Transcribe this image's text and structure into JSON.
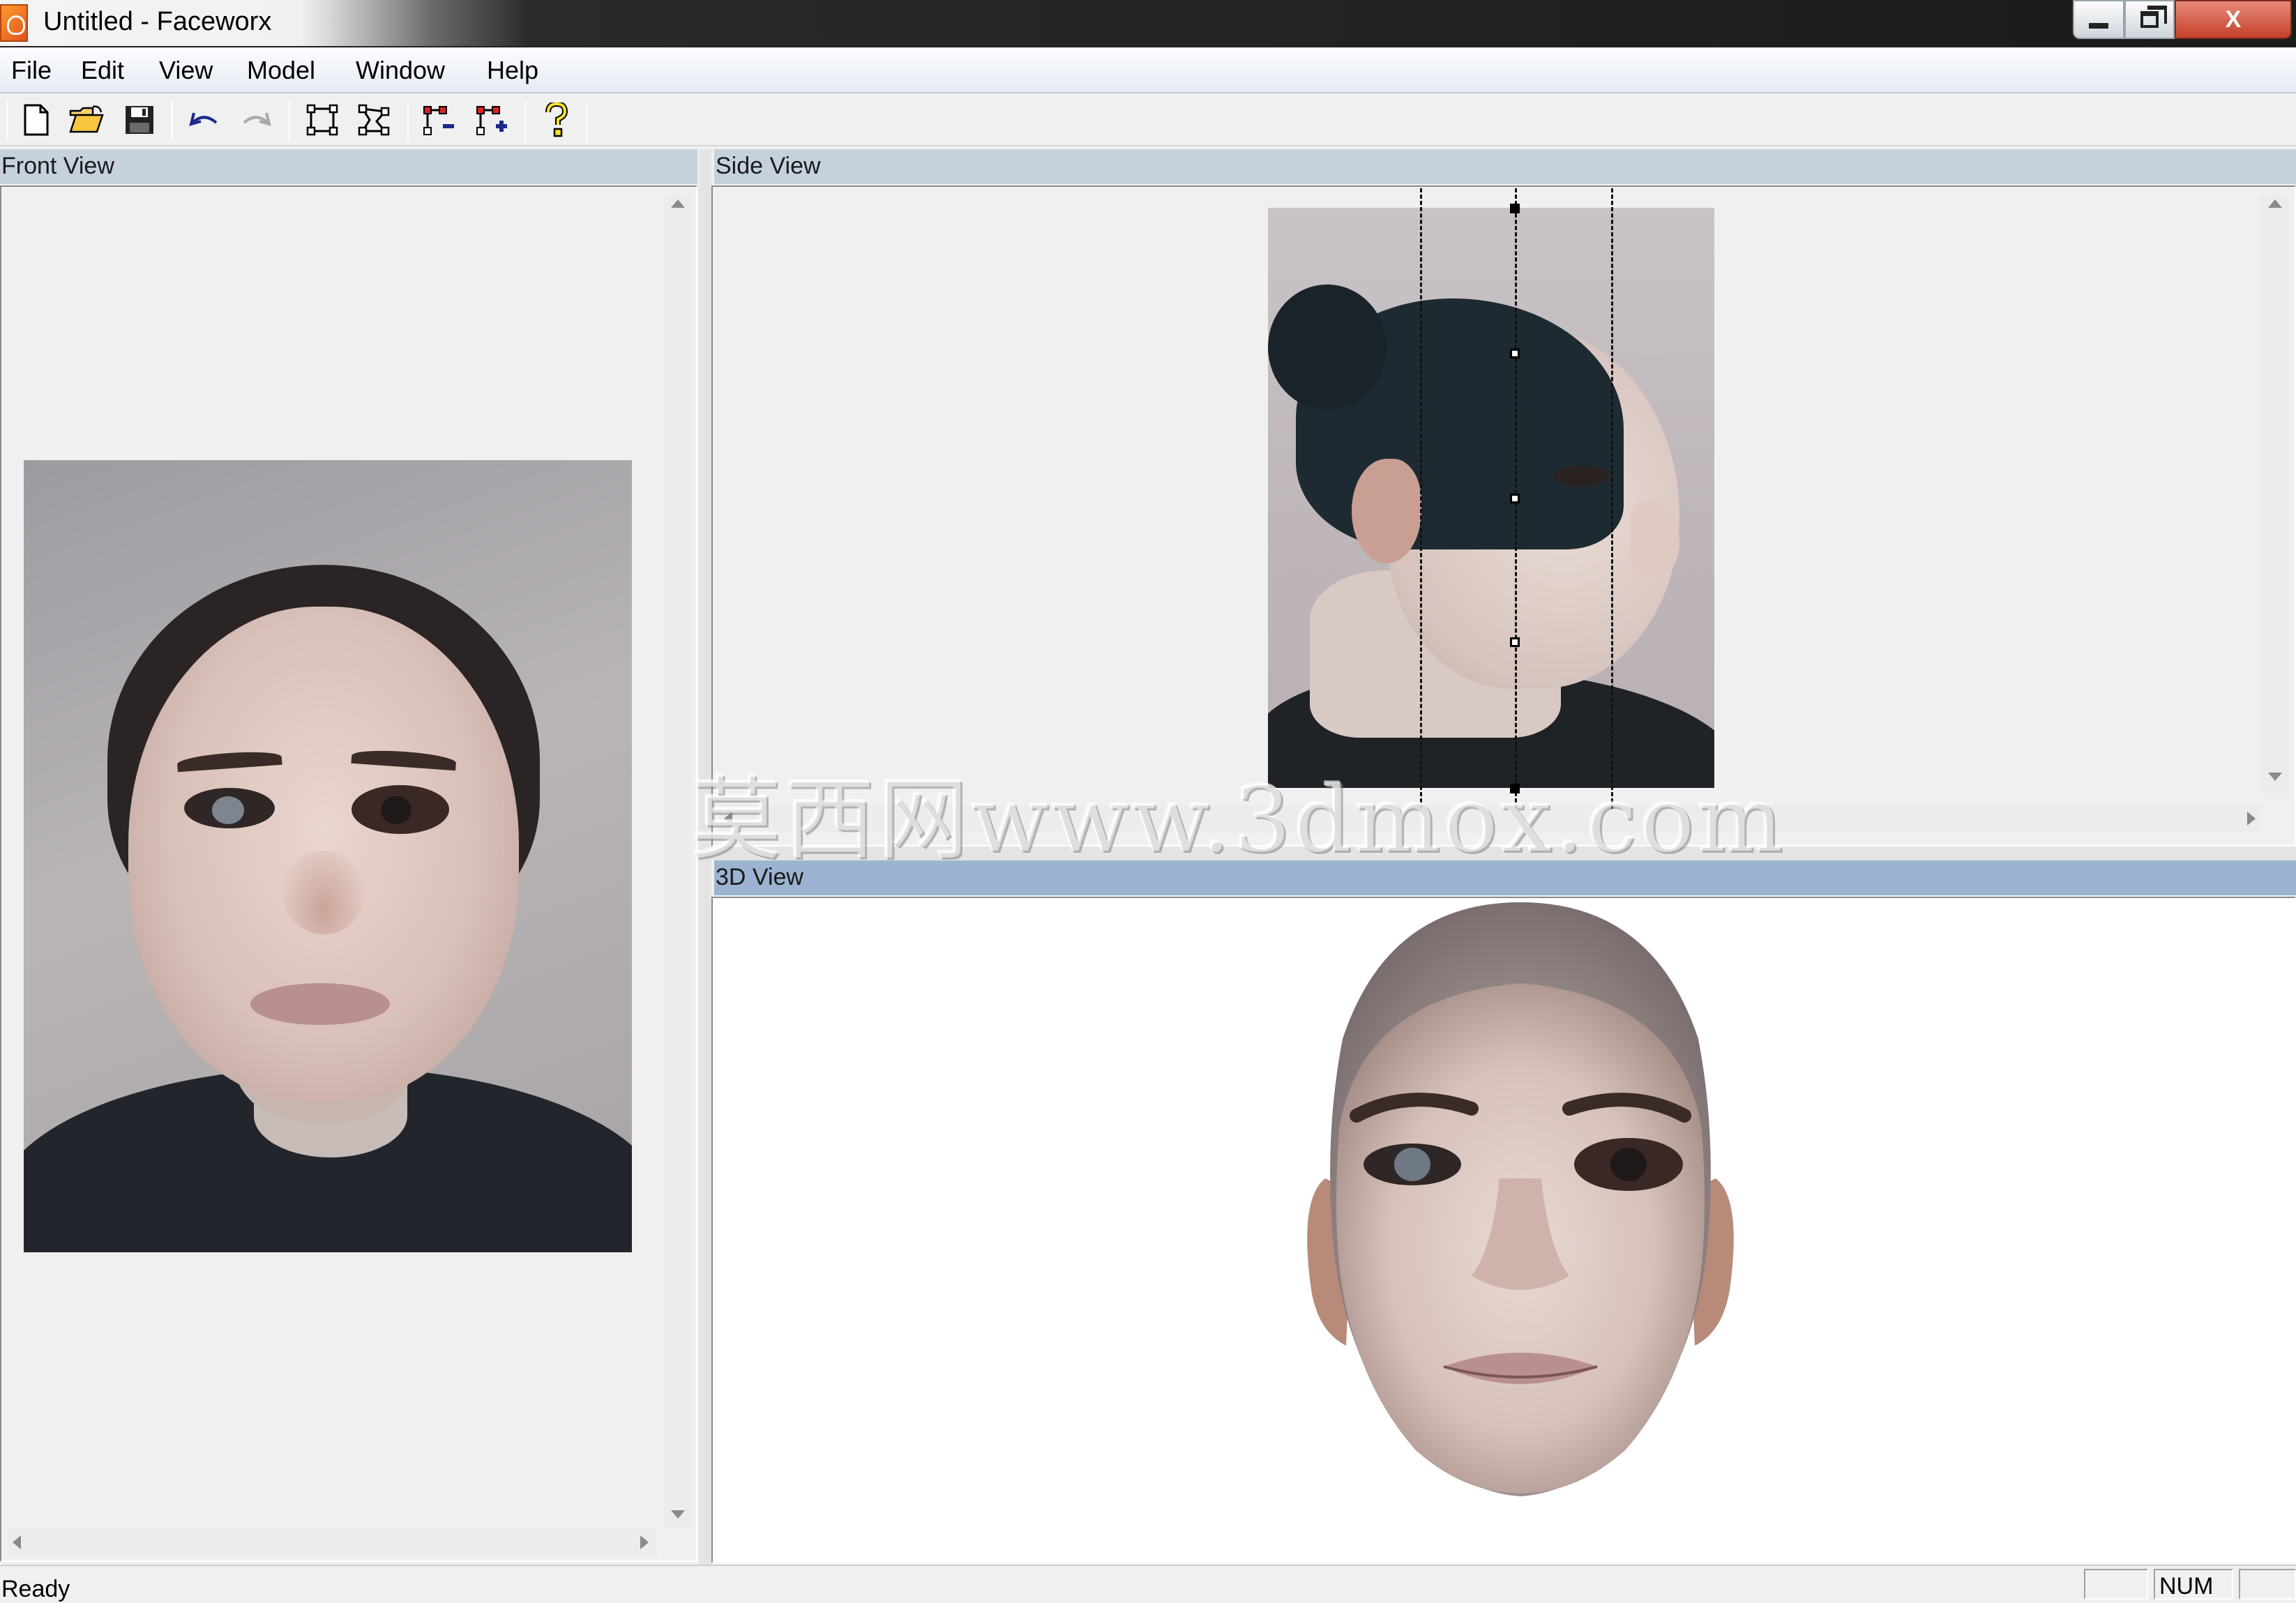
{
  "window": {
    "title": "Untitled - Faceworx",
    "controls": {
      "minimize": "minimize",
      "restore": "restore",
      "close": "X"
    }
  },
  "menu": [
    "File",
    "Edit",
    "View",
    "Model",
    "Window",
    "Help"
  ],
  "toolbar": {
    "buttons": [
      {
        "name": "new-file",
        "icon": "new-document-icon"
      },
      {
        "name": "open-file",
        "icon": "open-folder-icon"
      },
      {
        "name": "save-file",
        "icon": "floppy-disk-icon"
      },
      {
        "name": "undo",
        "icon": "undo-arrow-icon"
      },
      {
        "name": "redo",
        "icon": "redo-arrow-icon"
      },
      {
        "name": "select-frame",
        "icon": "frame-select-icon"
      },
      {
        "name": "select-points",
        "icon": "point-select-icon"
      },
      {
        "name": "remove-point",
        "icon": "point-minus-icon"
      },
      {
        "name": "add-point",
        "icon": "point-plus-icon"
      },
      {
        "name": "help",
        "icon": "question-mark-icon"
      }
    ]
  },
  "panes": {
    "front": {
      "title": "Front View"
    },
    "side": {
      "title": "Side View"
    },
    "view3d": {
      "title": "3D View"
    }
  },
  "watermark": "莫西网www.3dmox.com",
  "status": {
    "text": "Ready",
    "indicators": [
      "",
      "NUM",
      ""
    ]
  },
  "colors": {
    "pane_header": "#c6d1de",
    "pane_header_active": "#9cb4d1",
    "close_button": "#c4402a"
  }
}
